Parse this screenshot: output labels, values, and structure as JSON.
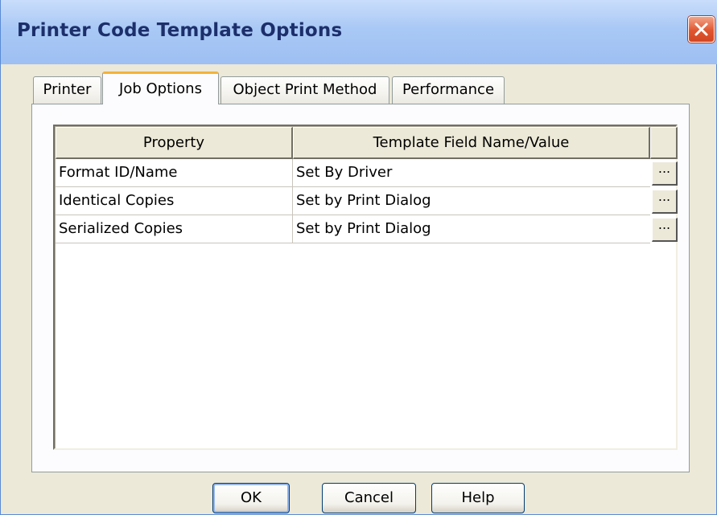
{
  "window": {
    "title": "Printer Code Template Options"
  },
  "tabs": [
    {
      "label": "Printer",
      "active": false
    },
    {
      "label": "Job Options",
      "active": true
    },
    {
      "label": "Object Print Method",
      "active": false
    },
    {
      "label": "Performance",
      "active": false
    }
  ],
  "table": {
    "headers": [
      "Property",
      "Template Field Name/Value",
      ""
    ],
    "rows": [
      {
        "property": "Format ID/Name",
        "value": "Set By Driver",
        "button": "..."
      },
      {
        "property": "Identical Copies",
        "value": "Set by Print Dialog",
        "button": "..."
      },
      {
        "property": "Serialized Copies",
        "value": "Set by Print Dialog",
        "button": "..."
      }
    ]
  },
  "buttons": {
    "ok": "OK",
    "cancel": "Cancel",
    "help": "Help"
  },
  "colors": {
    "title_text": "#1c2f6b",
    "close_button": "#e0562f",
    "active_tab_accent": "#f4b23a",
    "dialog_background": "#ece9d8"
  }
}
